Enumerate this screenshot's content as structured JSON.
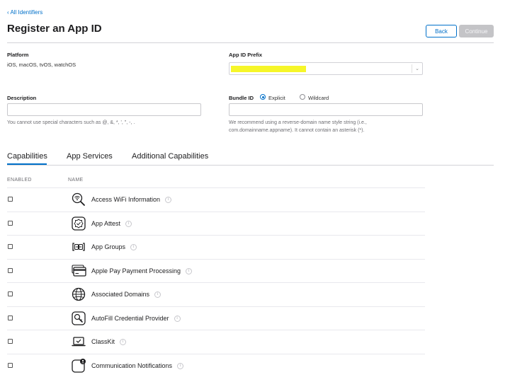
{
  "nav": {
    "back_link": "‹ All Identifiers"
  },
  "header": {
    "title": "Register an App ID",
    "back_button": "Back",
    "continue_button": "Continue"
  },
  "platform": {
    "label": "Platform",
    "value": "iOS, macOS, tvOS, watchOS"
  },
  "prefix": {
    "label": "App ID Prefix",
    "value": ""
  },
  "description": {
    "label": "Description",
    "value": "",
    "help": "You cannot use special characters such as @, &, *, ', \", -, ."
  },
  "bundle": {
    "label": "Bundle ID",
    "options": [
      {
        "label": "Explicit",
        "checked": true
      },
      {
        "label": "Wildcard",
        "checked": false
      }
    ],
    "value": "",
    "help_line1": "We recommend using a reverse-domain name style string (i.e.,",
    "help_line2": "com.domainname.appname). It cannot contain an asterisk (*)."
  },
  "tabs": [
    {
      "label": "Capabilities",
      "active": true
    },
    {
      "label": "App Services",
      "active": false
    },
    {
      "label": "Additional Capabilities",
      "active": false
    }
  ],
  "table": {
    "col_enabled": "ENABLED",
    "col_name": "NAME",
    "rows": [
      {
        "name": "Access WiFi Information",
        "icon": "wifi-search-icon",
        "enabled": false
      },
      {
        "name": "App Attest",
        "icon": "app-attest-icon",
        "enabled": false
      },
      {
        "name": "App Groups",
        "icon": "app-groups-icon",
        "enabled": false
      },
      {
        "name": "Apple Pay Payment Processing",
        "icon": "apple-pay-icon",
        "enabled": false
      },
      {
        "name": "Associated Domains",
        "icon": "globe-icon",
        "enabled": false
      },
      {
        "name": "AutoFill Credential Provider",
        "icon": "autofill-key-icon",
        "enabled": false
      },
      {
        "name": "ClassKit",
        "icon": "classkit-icon",
        "enabled": false
      },
      {
        "name": "Communication Notifications",
        "icon": "communication-notifications-icon",
        "enabled": false
      }
    ]
  },
  "colors": {
    "accent": "#0070c9",
    "highlight": "#f6f629",
    "disabled_button": "#c4c4c7"
  }
}
